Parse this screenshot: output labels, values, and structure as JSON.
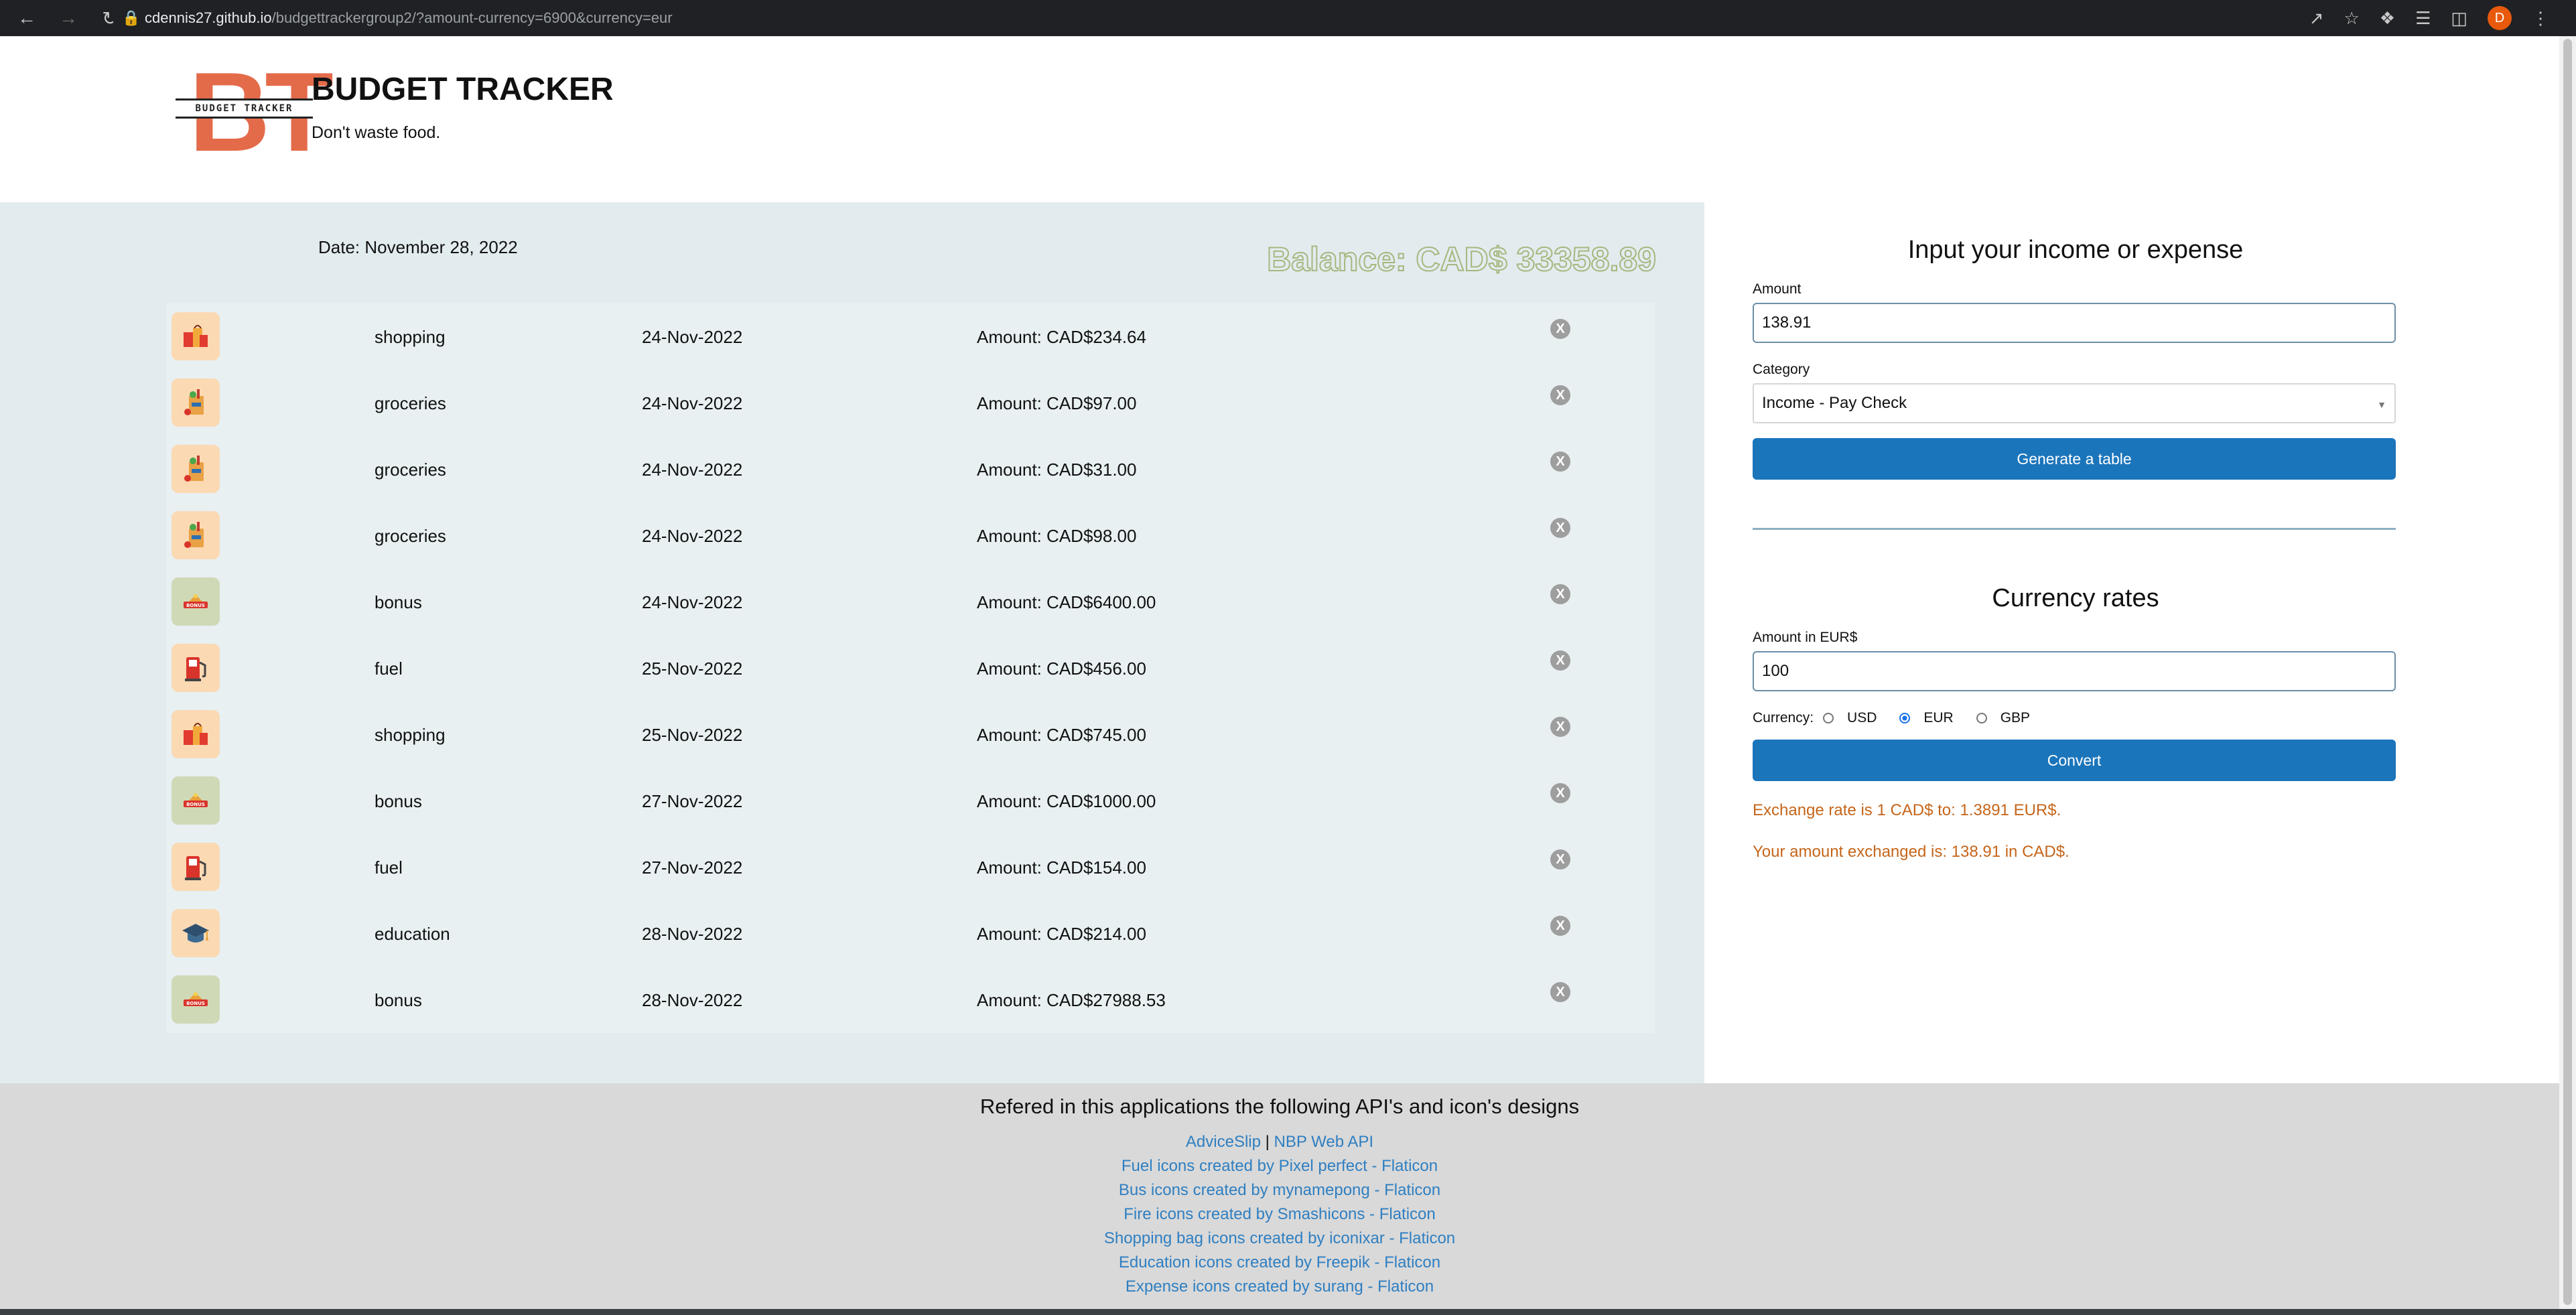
{
  "browser": {
    "url_host": "cdennis27.github.io",
    "url_path": "/budgettrackergroup2/?amount-currency=6900&currency=eur",
    "avatar_letter": "D"
  },
  "header": {
    "logo_letters": "BT",
    "logo_band": "BUDGET TRACKER",
    "title": "BUDGET TRACKER",
    "tagline": "Don't waste food."
  },
  "summary": {
    "date": "Date: November 28, 2022",
    "balance": "Balance: CAD$ 33358.89"
  },
  "transactions": [
    {
      "icon": "shopping-icon",
      "category": "shopping",
      "date": "24-Nov-2022",
      "amount": "Amount: CAD$234.64",
      "delete": "X"
    },
    {
      "icon": "groceries-icon",
      "category": "groceries",
      "date": "24-Nov-2022",
      "amount": "Amount: CAD$97.00",
      "delete": "X"
    },
    {
      "icon": "groceries-icon",
      "category": "groceries",
      "date": "24-Nov-2022",
      "amount": "Amount: CAD$31.00",
      "delete": "X"
    },
    {
      "icon": "groceries-icon",
      "category": "groceries",
      "date": "24-Nov-2022",
      "amount": "Amount: CAD$98.00",
      "delete": "X"
    },
    {
      "icon": "bonus-icon",
      "category": "bonus",
      "date": "24-Nov-2022",
      "amount": "Amount: CAD$6400.00",
      "delete": "X"
    },
    {
      "icon": "fuel-icon",
      "category": "fuel",
      "date": "25-Nov-2022",
      "amount": "Amount: CAD$456.00",
      "delete": "X"
    },
    {
      "icon": "shopping-icon",
      "category": "shopping",
      "date": "25-Nov-2022",
      "amount": "Amount: CAD$745.00",
      "delete": "X"
    },
    {
      "icon": "bonus-icon",
      "category": "bonus",
      "date": "27-Nov-2022",
      "amount": "Amount: CAD$1000.00",
      "delete": "X"
    },
    {
      "icon": "fuel-icon",
      "category": "fuel",
      "date": "27-Nov-2022",
      "amount": "Amount: CAD$154.00",
      "delete": "X"
    },
    {
      "icon": "education-icon",
      "category": "education",
      "date": "28-Nov-2022",
      "amount": "Amount: CAD$214.00",
      "delete": "X"
    },
    {
      "icon": "bonus-icon",
      "category": "bonus",
      "date": "28-Nov-2022",
      "amount": "Amount: CAD$27988.53",
      "delete": "X"
    }
  ],
  "entry_form": {
    "heading": "Input your income or expense",
    "amount_label": "Amount",
    "amount_value": "138.91",
    "category_label": "Category",
    "category_value": "Income - Pay Check",
    "submit_label": "Generate a table"
  },
  "currency_form": {
    "heading": "Currency rates",
    "amount_label": "Amount in EUR$",
    "amount_value": "100",
    "currency_label": "Currency:",
    "options": [
      "USD",
      "EUR",
      "GBP"
    ],
    "selected": "EUR",
    "convert_label": "Convert",
    "rate_text": "Exchange rate is 1 CAD$ to: 1.3891 EUR$.",
    "result_text": "Your amount exchanged is: 138.91 in CAD$."
  },
  "footer": {
    "heading": "Refered in this applications the following API's and icon's designs",
    "api_link_1": "AdviceSlip",
    "api_separator": "|",
    "api_link_2": "NBP Web API",
    "links": [
      "Fuel icons created by Pixel perfect - Flaticon",
      "Bus icons created by mynamepong - Flaticon",
      "Fire icons created by Smashicons - Flaticon",
      "Shopping bag icons created by iconixar - Flaticon",
      "Education icons created by Freepik - Flaticon",
      "Expense icons created by surang - Flaticon"
    ]
  }
}
